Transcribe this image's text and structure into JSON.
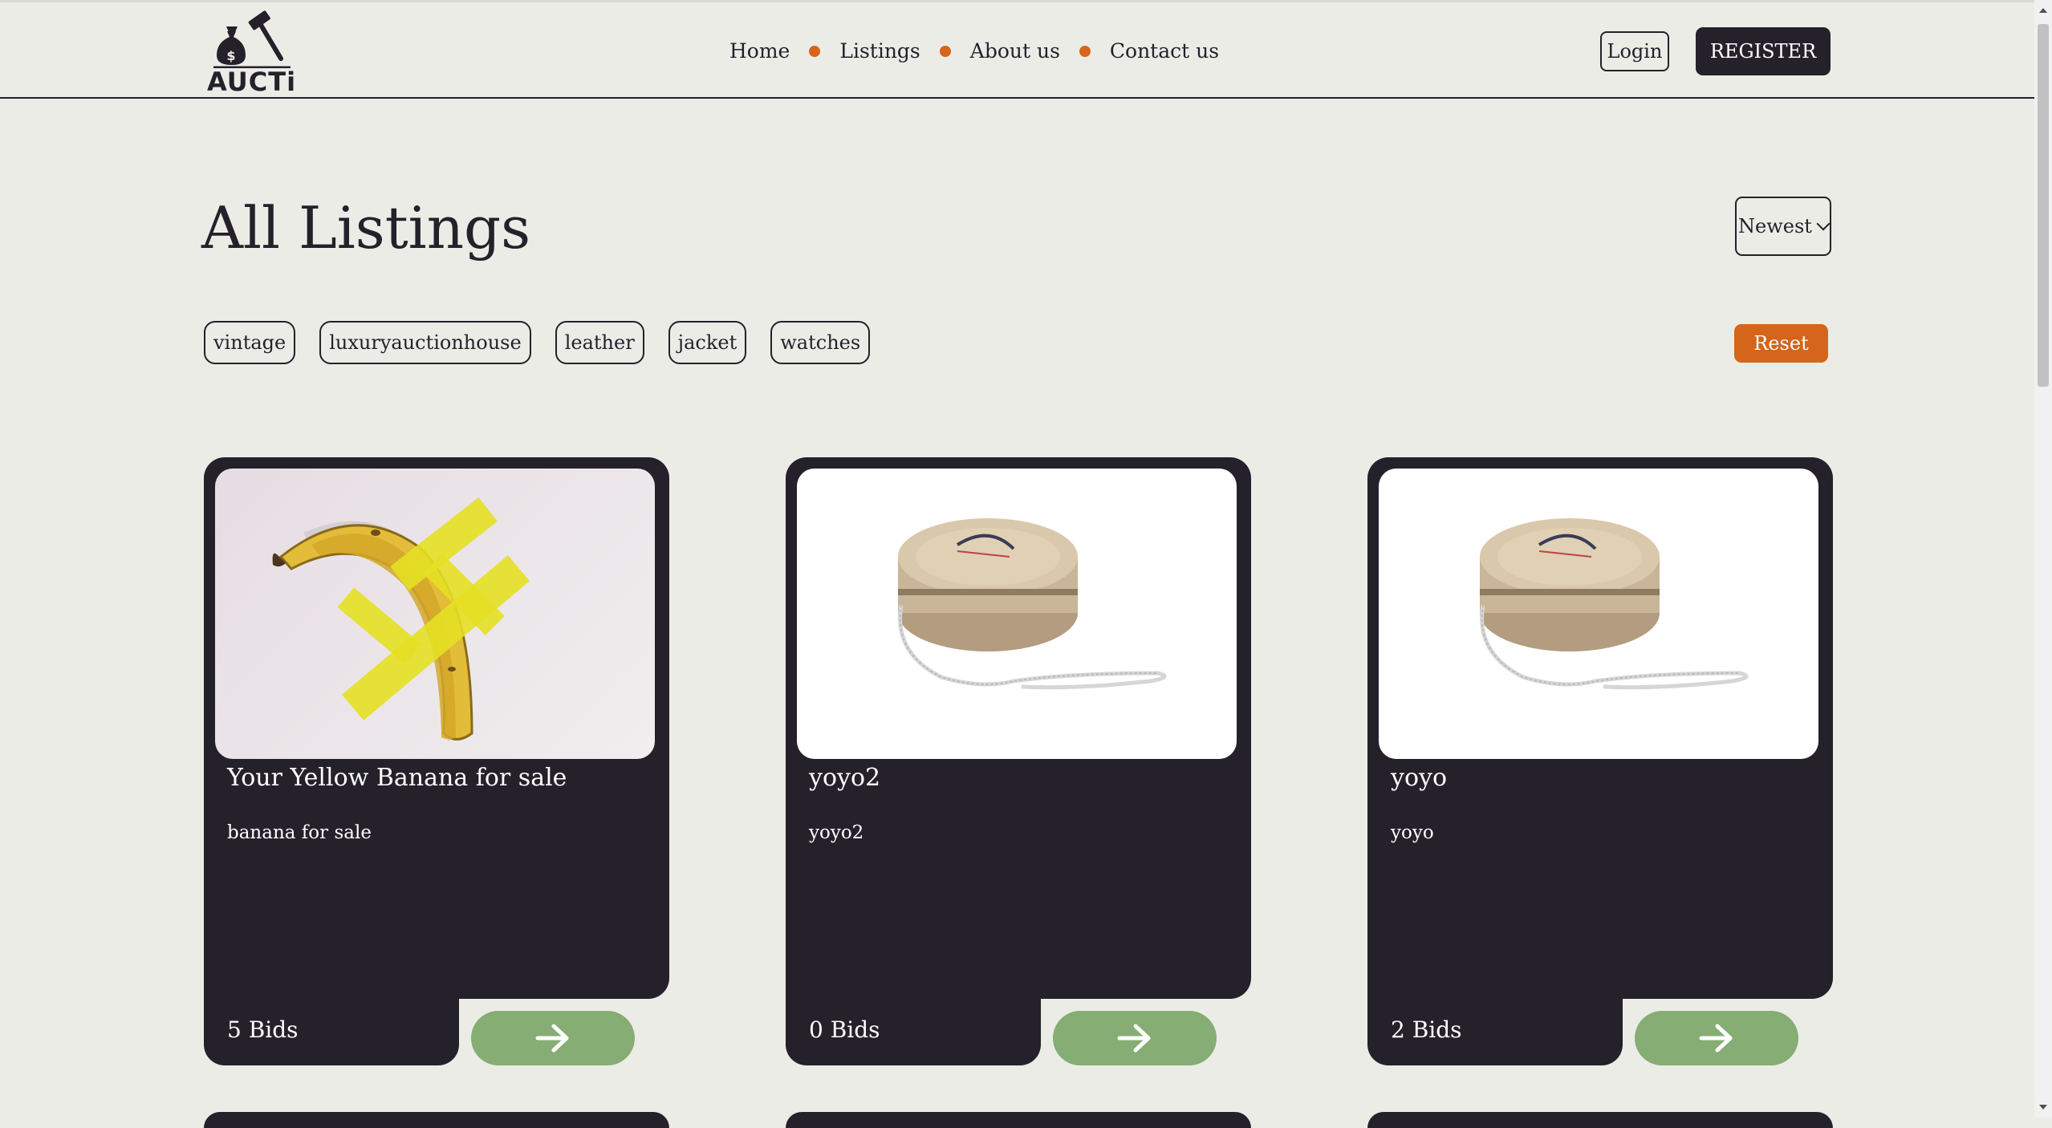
{
  "brand": {
    "name": "AUCTi"
  },
  "nav": {
    "items": [
      {
        "label": "Home"
      },
      {
        "label": "Listings"
      },
      {
        "label": "About us"
      },
      {
        "label": "Contact us"
      }
    ]
  },
  "auth": {
    "login_label": "Login",
    "register_label": "REGISTER"
  },
  "page": {
    "title": "All Listings"
  },
  "sort": {
    "selected": "Newest"
  },
  "filters": {
    "tags": [
      "vintage",
      "luxuryauctionhouse",
      "leather",
      "jacket",
      "watches"
    ],
    "reset_label": "Reset"
  },
  "listings": [
    {
      "title": "Your Yellow Banana for sale",
      "description": "banana for sale",
      "bids": "5 Bids"
    },
    {
      "title": "yoyo2",
      "description": "yoyo2",
      "bids": "0 Bids"
    },
    {
      "title": "yoyo",
      "description": "yoyo",
      "bids": "2 Bids"
    }
  ],
  "colors": {
    "background": "#ecece7",
    "dark": "#24212b",
    "accent_orange": "#d4651a",
    "arrow_green": "#86ad73"
  }
}
